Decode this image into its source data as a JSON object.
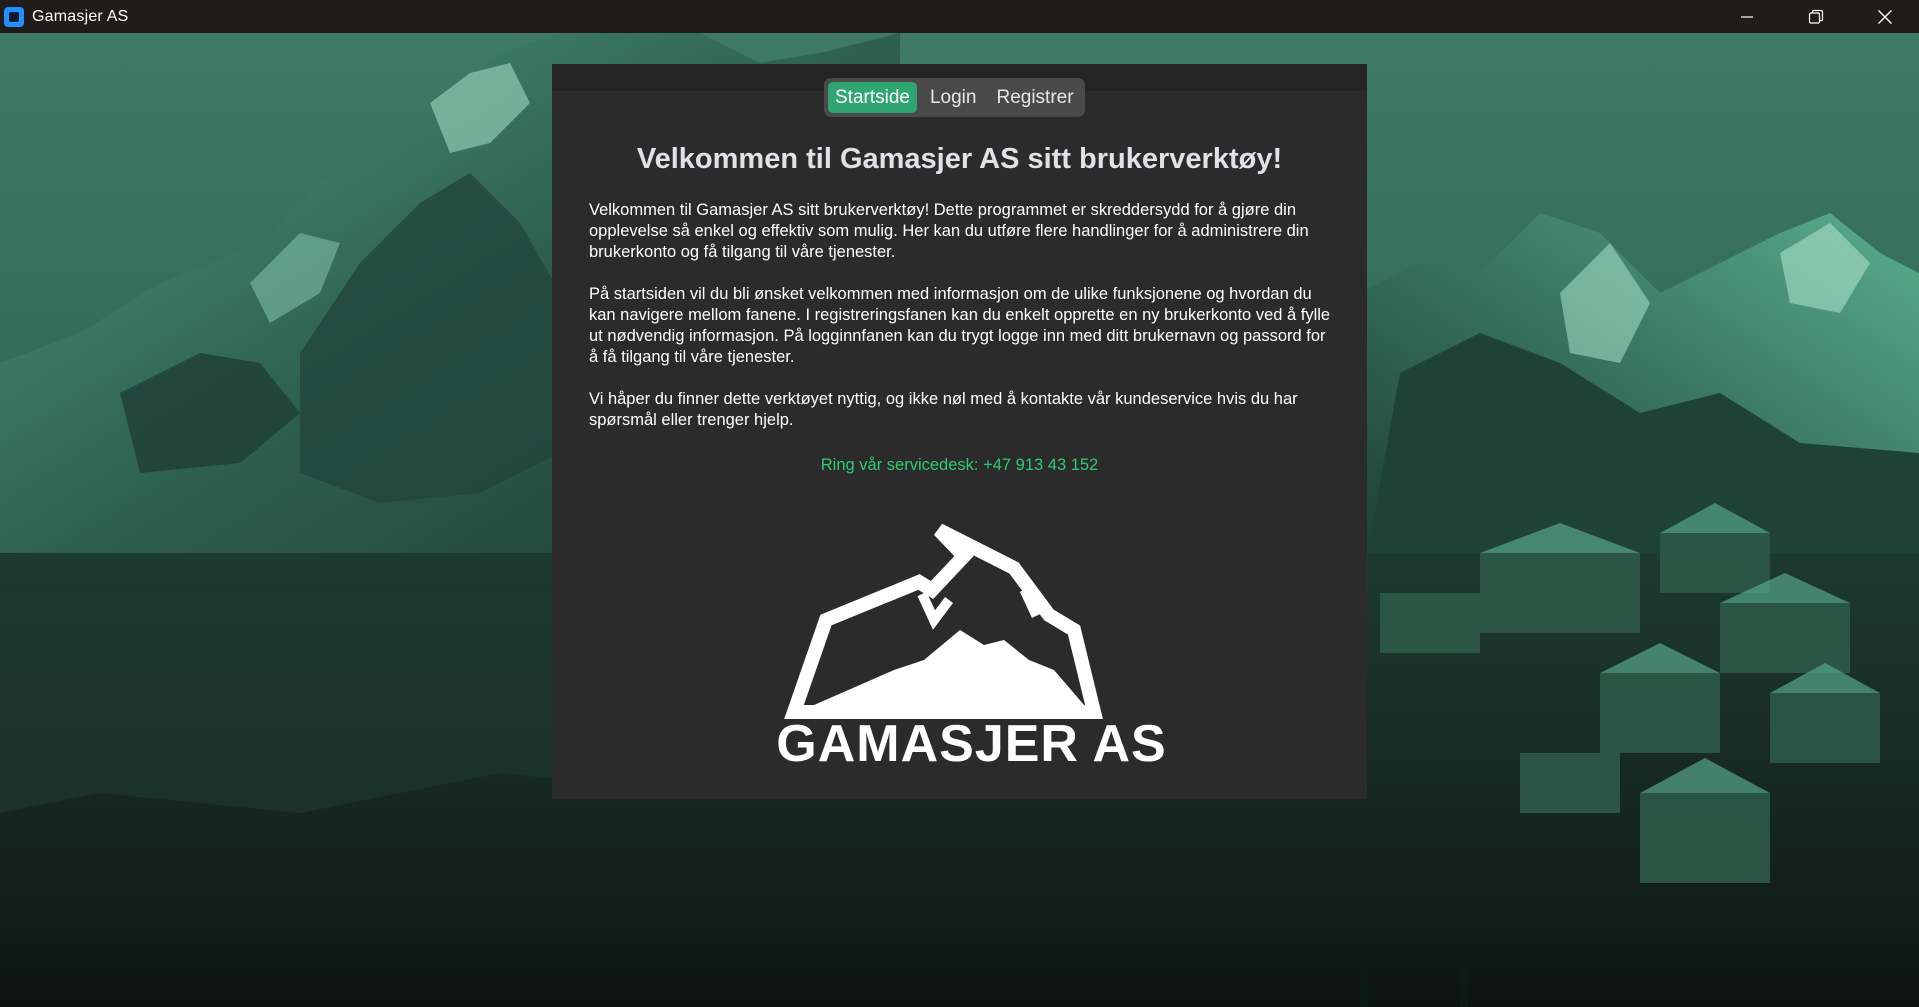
{
  "window": {
    "title": "Gamasjer AS",
    "icon": "app-icon",
    "controls": [
      "minimize-icon",
      "restore-icon",
      "close-icon"
    ]
  },
  "tabs": [
    {
      "label": "Startside",
      "active": true
    },
    {
      "label": "Login",
      "active": false
    },
    {
      "label": "Registrer",
      "active": false
    }
  ],
  "content": {
    "title": "Velkommen til Gamasjer AS sitt brukerverktøy!",
    "paragraphs": [
      "Velkommen til Gamasjer AS sitt brukerverktøy! Dette programmet er skreddersydd for å gjøre din opplevelse så enkel og effektiv som mulig. Her kan du utføre flere handlinger for å administrere din brukerkonto og få tilgang til våre tjenester.",
      "På startsiden vil du bli ønsket velkommen med informasjon om de ulike funksjonene og hvordan du kan navigere mellom fanene. I registreringsfanen kan du enkelt opprette en ny brukerkonto ved å fylle ut nødvendig informasjon. På logginnfanen kan du trygt logge inn med ditt brukernavn og passord for å få tilgang til våre tjenester.",
      "Vi håper du finner dette verktøyet nyttig, og ikke nøl med å kontakte vår kundeservice hvis du har spørsmål eller trenger hjelp."
    ],
    "servicedesk": "Ring vår servicedesk: +47 913 43 152"
  },
  "logo": {
    "text": "GAMASJER AS"
  },
  "colors": {
    "accent": "#2fa572",
    "servicedesk": "#2ecc71",
    "panel": "#2b2b2b",
    "titlebar": "#1f1c1a"
  }
}
